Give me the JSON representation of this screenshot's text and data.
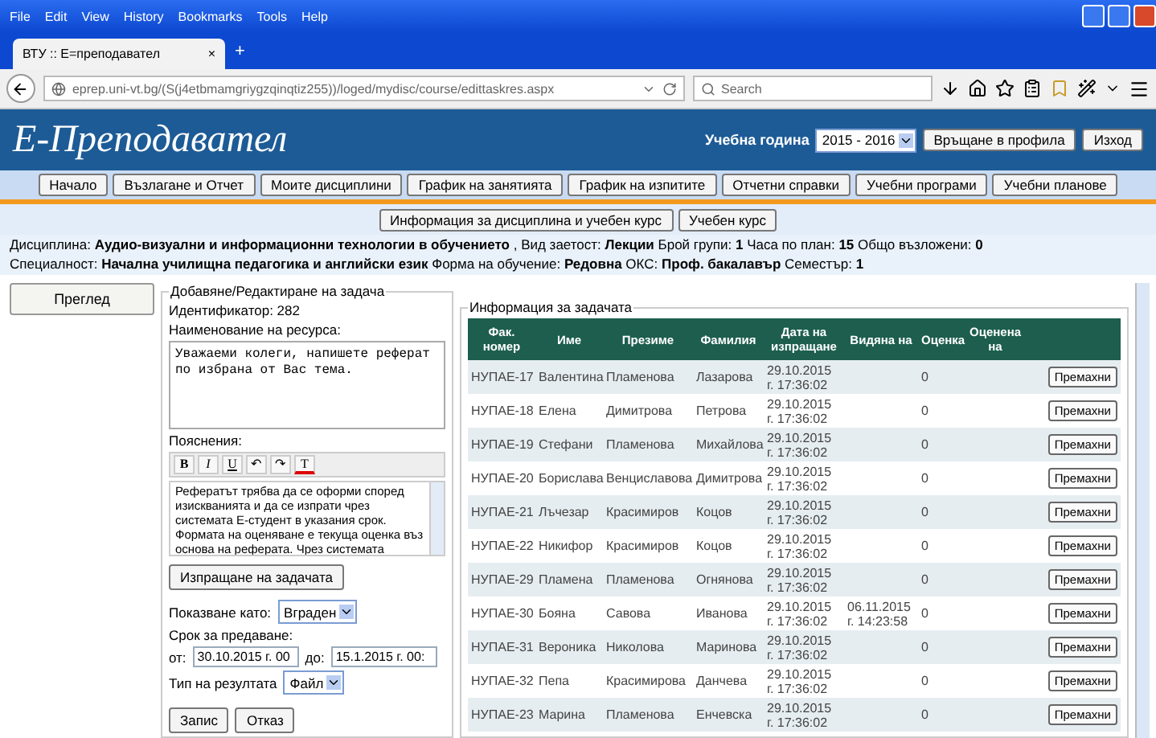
{
  "browser": {
    "menu": [
      "File",
      "Edit",
      "View",
      "History",
      "Bookmarks",
      "Tools",
      "Help"
    ],
    "tab": {
      "title": "ВТУ :: Е=преподавател",
      "close": "×"
    },
    "new_tab": "+",
    "url": "eprep.uni-vt.bg/(S(j4etbmamgriygzqinqtiz255))/loged/mydisc/course/edittaskres.aspx",
    "search": {
      "placeholder": "Search"
    }
  },
  "header": {
    "logo": "Е-Преподавател",
    "year_label": "Учебна година",
    "year": "2015 - 2016",
    "buttons": [
      "Връщане в профила",
      "Изход"
    ]
  },
  "nav": [
    "Начало",
    "Възлагане и Отчет",
    "Моите дисциплини",
    "График на занятията",
    "График на изпитите",
    "Отчетни справки",
    "Учебни програми",
    "Учебни планове"
  ],
  "subnav": [
    "Информация за дисциплина и учебен курс",
    "Учебен курс"
  ],
  "info": [
    "Дисциплина: **Аудио-визуални и информационни технологии в обучението** , Вид заетост: **Лекции** Брой групи: **1** Часа по план: **15** Общо възложени: **0**",
    "Специалност: **Начална училищна педагогика и английски език** Форма на обучение: **Редовна** ОКС: **Проф. бакалавър** Семестър: **1**"
  ],
  "sidebar": {
    "button": "Преглед"
  },
  "form": {
    "legend": "Добавяне/Редактиране на задача",
    "id_line": "Идентификатор: 282",
    "name_label": "Наименование на ресурса:",
    "name_value": "Уважаеми колеги, напишете реферат по избрана от Вас тема.",
    "notes_label": "Пояснения:",
    "toolbar": [
      "B",
      "I",
      "U",
      "↶",
      "↷",
      "T"
    ],
    "notes": [
      "Рефератът трябва да се оформи според изискванията и да се изпрати чрез системата Е-студент в указания срок.",
      "Формата на оценяване е текуща оценка въз основа на реферата. Чрез системата"
    ],
    "send_button": "Изпращане на задачата",
    "show_label": "Показване като:",
    "show_value": "Вграден",
    "deadline_label": "Срок за предаване:",
    "from_label": "от:",
    "from_value": "30.10.2015 г. 00",
    "to_label": "до:",
    "to_value": "15.1.2015 г. 00:",
    "result_label": "Тип на резултата",
    "result_value": "Файл",
    "buttons": [
      "Запис",
      "Отказ"
    ]
  },
  "table": {
    "legend": "Информация за задачата",
    "columns": [
      "Фак. номер",
      "Име",
      "Презиме",
      "Фамилия",
      "Дата на изпращане",
      "Видяна на",
      "Оценка",
      "Оценена на"
    ],
    "rows": [
      {
        "fak": "НУПАЕ-17",
        "first": "Валентина",
        "middle": "Пламенова",
        "last": "Лазарова",
        "sent": "29.10.2015 г. 17:36:02",
        "grade": "0",
        "action": "Премахни"
      },
      {
        "fak": "НУПАЕ-18",
        "first": "Елена",
        "middle": "Димитрова",
        "last": "Петрова",
        "sent": "29.10.2015 г. 17:36:02",
        "grade": "0",
        "action": "Премахни"
      },
      {
        "fak": "НУПАЕ-19",
        "first": "Стефани",
        "middle": "Пламенова",
        "last": "Михайлова",
        "sent": "29.10.2015 г. 17:36:02",
        "grade": "0",
        "action": "Премахни"
      },
      {
        "fak": "НУПАЕ-20",
        "first": "Борислава",
        "middle": "Венциславова",
        "last": "Димитрова",
        "sent": "29.10.2015 г. 17:36:02",
        "grade": "0",
        "action": "Премахни"
      },
      {
        "fak": "НУПАЕ-21",
        "first": "Лъчезар",
        "middle": "Красимиров",
        "last": "Коцов",
        "sent": "29.10.2015 г. 17:36:02",
        "grade": "0",
        "action": "Премахни"
      },
      {
        "fak": "НУПАЕ-22",
        "first": "Никифор",
        "middle": "Красимиров",
        "last": "Коцов",
        "sent": "29.10.2015 г. 17:36:02",
        "grade": "0",
        "action": "Премахни"
      },
      {
        "fak": "НУПАЕ-29",
        "first": "Пламена",
        "middle": "Пламенова",
        "last": "Огнянова",
        "sent": "29.10.2015 г. 17:36:02",
        "grade": "0",
        "action": "Премахни"
      },
      {
        "fak": "НУПАЕ-30",
        "first": "Бояна",
        "middle": "Савова",
        "last": "Иванова",
        "sent": "29.10.2015 г. 17:36:02",
        "seen": "06.11.2015 г. 14:23:58",
        "grade": "0",
        "action": "Премахни"
      },
      {
        "fak": "НУПАЕ-31",
        "first": "Вероника",
        "middle": "Николова",
        "last": "Маринова",
        "sent": "29.10.2015 г. 17:36:02",
        "grade": "0",
        "action": "Премахни"
      },
      {
        "fak": "НУПАЕ-32",
        "first": "Пепа",
        "middle": "Красимирова",
        "last": "Данчева",
        "sent": "29.10.2015 г. 17:36:02",
        "grade": "0",
        "action": "Премахни"
      },
      {
        "fak": "НУПАЕ-23",
        "first": "Марина",
        "middle": "Пламенова",
        "last": "Енчевска",
        "sent": "29.10.2015 г. 17:36:02",
        "grade": "0",
        "action": "Премахни"
      }
    ]
  }
}
